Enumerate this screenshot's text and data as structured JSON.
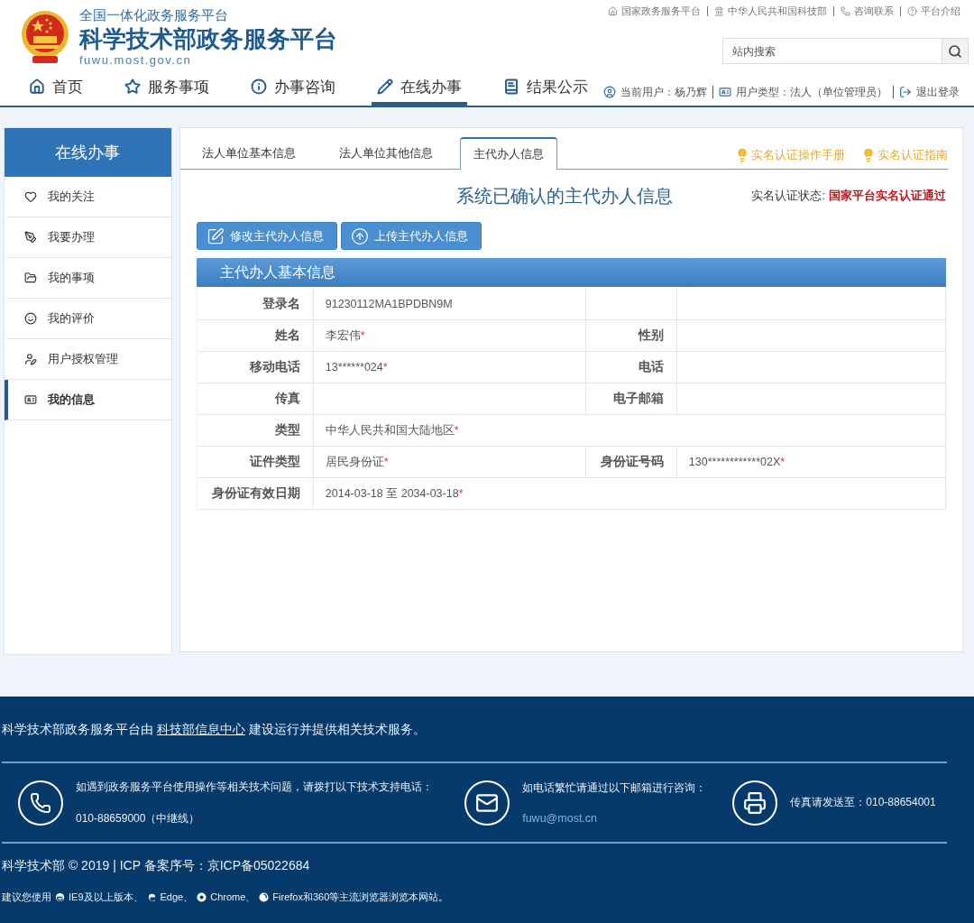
{
  "header": {
    "subtitle": "全国一体化政务服务平台",
    "title": "科学技术部政务服务平台",
    "domain": "fuwu.most.gov.cn",
    "top_links": [
      {
        "kind": "home",
        "label": "国家政务服务平台"
      },
      {
        "kind": "bank",
        "label": "中华人民共和国科技部"
      },
      {
        "kind": "phone",
        "label": "咨询联系"
      },
      {
        "kind": "help",
        "label": "平台介绍"
      }
    ],
    "search": {
      "placeholder": "站内搜索"
    },
    "nav": [
      {
        "kind": "home",
        "label": "首页",
        "selected": false
      },
      {
        "kind": "star",
        "label": "服务事项",
        "selected": false
      },
      {
        "kind": "info",
        "label": "办事咨询",
        "selected": false
      },
      {
        "kind": "pencil",
        "label": "在线办事",
        "selected": true
      },
      {
        "kind": "book",
        "label": "结果公示",
        "selected": false
      }
    ],
    "user_links": [
      {
        "kind": "user",
        "label": "当前用户：杨乃辉"
      },
      {
        "kind": "card",
        "label": "用户类型：法人（单位管理员）"
      },
      {
        "kind": "logout",
        "label": "退出登录"
      }
    ]
  },
  "sidebar": {
    "title": "在线办事",
    "items": [
      {
        "kind": "heart",
        "label": "我的关注",
        "selected": false
      },
      {
        "kind": "pen",
        "label": "我要办理",
        "selected": false
      },
      {
        "kind": "folder",
        "label": "我的事项",
        "selected": false
      },
      {
        "kind": "smile",
        "label": "我的评价",
        "selected": false
      },
      {
        "kind": "user-edit",
        "label": "用户授权管理",
        "selected": false
      },
      {
        "kind": "card",
        "label": "我的信息",
        "selected": true
      }
    ]
  },
  "tabs": [
    {
      "label": "法人单位基本信息",
      "selected": false
    },
    {
      "label": "法人单位其他信息",
      "selected": false
    },
    {
      "label": "主代办人信息",
      "selected": true
    }
  ],
  "help_links": [
    "实名认证操作手册",
    "实名认证指南"
  ],
  "heading": "系统已确认的主代办人信息",
  "status": {
    "label": "实名认证状态:",
    "value": "国家平台实名认证通过"
  },
  "buttons": [
    {
      "kind": "edit",
      "label": "修改主代办人信息"
    },
    {
      "kind": "upload",
      "label": "上传主代办人信息"
    }
  ],
  "section_title": "主代办人基本信息",
  "rows": [
    {
      "kind": "pair",
      "fields": [
        {
          "label": "登录名",
          "value": "91230112MA1BPDBN9M"
        }
      ]
    },
    {
      "kind": "pair",
      "fields": [
        {
          "label": "姓名",
          "value": "李宏伟",
          "mark": "*"
        },
        {
          "label": "性别"
        }
      ]
    },
    {
      "kind": "pair",
      "fields": [
        {
          "label": "移动电话",
          "value": "13******024",
          "mark": "*"
        },
        {
          "label": "电话"
        }
      ]
    },
    {
      "kind": "pair",
      "fields": [
        {
          "label": "传真"
        },
        {
          "label": "电子邮箱"
        }
      ]
    },
    {
      "kind": "wide",
      "fields": [
        {
          "label": "类型",
          "value": "中华人民共和国大陆地区 ",
          "mark": "*"
        }
      ]
    },
    {
      "kind": "pair",
      "fields": [
        {
          "label": "证件类型",
          "value": "居民身份证 ",
          "mark": "*"
        },
        {
          "label": "身份证号码",
          "value": "130************02X",
          "mark": "*"
        }
      ]
    },
    {
      "kind": "wide",
      "fields": [
        {
          "label": "身份证有效日期",
          "value": "2014-03-18 至 2034-03-18 ",
          "mark": "*"
        }
      ]
    }
  ],
  "footer": {
    "statement": {
      "before": "科学技术部政务服务平台由 ",
      "link": "科技部信息中心",
      "after": " 建设运行并提供相关技术服务。"
    },
    "contacts": [
      {
        "kind": "phone",
        "text": "如遇到政务服务平台使用操作等相关技术问题，请拨打以下技术支持电话：",
        "detail": "010-88659000（中继线）"
      },
      {
        "kind": "email",
        "text": "如电话繁忙请通过以下邮箱进行咨询：",
        "link": "fuwu@most.cn"
      },
      {
        "kind": "fax",
        "text": "传真请发送至：010-88654001"
      }
    ],
    "copyright": "科学技术部 © 2019 | ICP 备案序号：京ICP备05022684",
    "browser_note": {
      "lead": "建议您使用",
      "items": [
        {
          "kind": "ie",
          "text": "IE9及以上版本、"
        },
        {
          "kind": "edge",
          "text": "Edge、"
        },
        {
          "kind": "chrome",
          "text": "Chrome、"
        },
        {
          "kind": "firefox",
          "text": "Firefox和360等主流浏览器浏览本网站。"
        }
      ]
    }
  }
}
